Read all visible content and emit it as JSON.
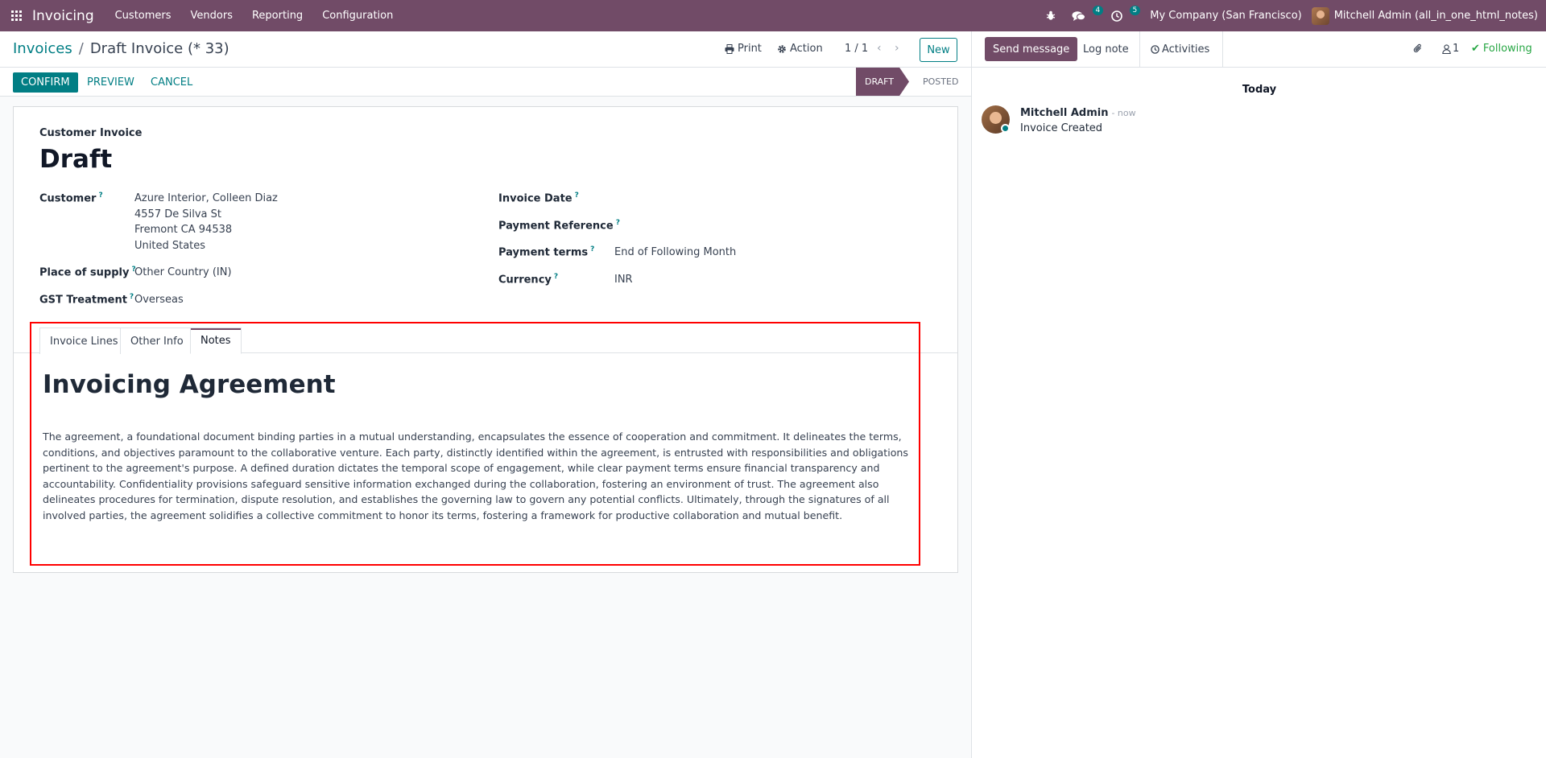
{
  "navbar": {
    "app_name": "Invoicing",
    "menu": [
      "Customers",
      "Vendors",
      "Reporting",
      "Configuration"
    ],
    "messages_badge": "4",
    "activities_badge": "5",
    "company": "My Company (San Francisco)",
    "user": "Mitchell Admin (all_in_one_html_notes)"
  },
  "control": {
    "breadcrumb_parent": "Invoices",
    "breadcrumb_sep": "/",
    "breadcrumb_current": "Draft Invoice (* 33)",
    "print_label": "Print",
    "action_label": "Action",
    "pager": "1 / 1",
    "new_label": "New"
  },
  "statusbar": {
    "confirm": "Confirm",
    "preview": "Preview",
    "cancel": "Cancel",
    "draft": "Draft",
    "posted": "Posted"
  },
  "form": {
    "subtitle": "Customer Invoice",
    "title": "Draft",
    "customer_label": "Customer",
    "customer_lines": [
      "Azure Interior, Colleen Diaz",
      "4557 De Silva St",
      "Fremont CA 94538",
      "United States"
    ],
    "place_label": "Place of supply",
    "place_value": "Other Country (IN)",
    "gst_label": "GST Treatment",
    "gst_value": "Overseas",
    "invoice_date_label": "Invoice Date",
    "payment_ref_label": "Payment Reference",
    "payment_terms_label": "Payment terms",
    "payment_terms_value": "End of Following Month",
    "currency_label": "Currency",
    "currency_value": "INR",
    "help_mark": "?"
  },
  "tabs": [
    "Invoice Lines",
    "Other Info",
    "Notes"
  ],
  "notes": {
    "title": "Invoicing Agreement",
    "body": "The agreement, a foundational document binding parties in a mutual understanding, encapsulates the essence of cooperation and commitment. It delineates the terms, conditions, and objectives paramount to the collaborative venture. Each party, distinctly identified within the agreement, is entrusted with responsibilities and obligations pertinent to the agreement's purpose. A defined duration dictates the temporal scope of engagement, while clear payment terms ensure financial transparency and accountability. Confidentiality provisions safeguard sensitive information exchanged during the collaboration, fostering an environment of trust. The agreement also delineates procedures for termination, dispute resolution, and establishes the governing law to govern any potential conflicts. Ultimately, through the signatures of all involved parties, the agreement solidifies a collective commitment to honor its terms, fostering a framework for productive collaboration and mutual benefit."
  },
  "chatter": {
    "send_message": "Send message",
    "log_note": "Log note",
    "activities": "Activities",
    "followers_count": "1",
    "following": "Following",
    "today": "Today",
    "author": "Mitchell Admin",
    "time": "- now",
    "message": "Invoice Created"
  },
  "colors": {
    "brand": "#714b67",
    "accent": "#017e84",
    "highlight": "#ff0000",
    "following": "#28a745"
  }
}
